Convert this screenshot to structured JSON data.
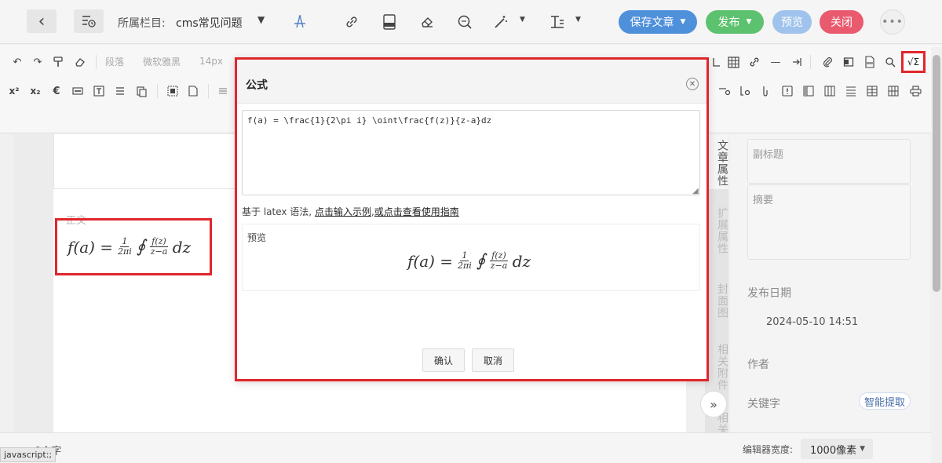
{
  "header": {
    "column_label": "所属栏目:",
    "column_value": "cms常见问题",
    "save_label": "保存文章",
    "publish_label": "发布",
    "preview_label": "预览",
    "close_label": "关闭",
    "colors": {
      "save": "#4f90db",
      "publish": "#5dc26f",
      "preview": "#9fc3ec",
      "close": "#ea5a6e"
    }
  },
  "toolbar": {
    "paragraph_select": "段落",
    "font_select": "微软雅黑",
    "size_select": "14px",
    "formula_label": "√Σ"
  },
  "editor": {
    "body_label": "正文",
    "formula_preview": {
      "lhs": "f(a) =",
      "frac1_num": "1",
      "frac1_den": "2πi",
      "integral": "∮",
      "frac2_num": "f(z)",
      "frac2_den": "z−a",
      "tail": "dz"
    }
  },
  "side_tabs": [
    "文章属性",
    "扩展属性",
    "封面图",
    "相关附件",
    "相关"
  ],
  "right_panel": {
    "subtitle_placeholder": "副标题",
    "summary_placeholder": "摘要",
    "publish_date_label": "发布日期",
    "publish_date_value": "2024-05-10 14:51",
    "author_label": "作者",
    "keyword_label": "关键字",
    "smart_extract_label": "智能提取"
  },
  "status": {
    "word_count": "0个字",
    "js_tip": "javascript:;",
    "width_label": "编辑器宽度:",
    "width_value": "1000像素"
  },
  "modal": {
    "title": "公式",
    "latex_value": "f(a) = \\frac{1}{2\\pi i} \\oint\\frac{f(z)}{z-a}dz",
    "hint_prefix": "基于 latex 语法,",
    "hint_link1": "点击输入示例",
    "hint_sep": ",",
    "hint_link2": "或点击查看使用指南",
    "preview_label": "预览",
    "confirm_label": "确认",
    "cancel_label": "取消"
  }
}
